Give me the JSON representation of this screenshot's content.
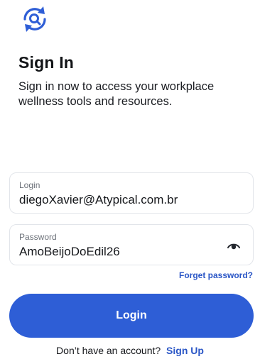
{
  "app": {
    "logo_icon": "sync-search-icon",
    "accent_color": "#2e5ed6"
  },
  "header": {
    "title": "Sign In",
    "subtitle": "Sign in now to access your workplace wellness tools and resources."
  },
  "form": {
    "login": {
      "label": "Login",
      "value": "diegoXavier@Atypical.com.br"
    },
    "password": {
      "label": "Password",
      "value": "AmoBeijoDoEdil26",
      "toggle_icon": "eye-icon"
    },
    "forgot_label": "Forget password?",
    "submit_label": "Login"
  },
  "footer": {
    "prompt": "Don’t have an account?",
    "signup_label": "Sign Up"
  }
}
